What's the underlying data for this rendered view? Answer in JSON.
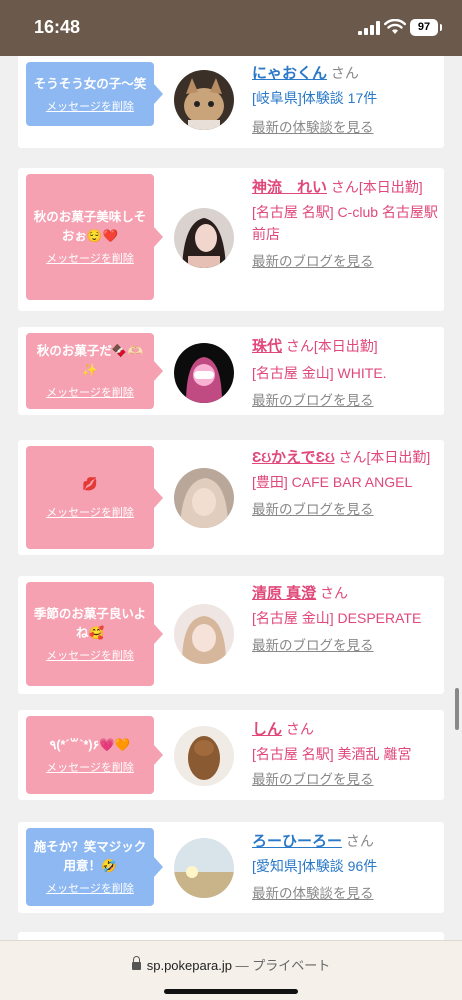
{
  "status_bar": {
    "time": "16:48",
    "battery": "97"
  },
  "feed": [
    {
      "bubble_text": "そうそう女の子〜笑",
      "delete_label": "メッセージを削除",
      "name": "にゃおくん",
      "honorific": "さん",
      "meta": "[岐阜県]体験談 17件",
      "link": "最新の体験談を見る"
    },
    {
      "bubble_text": "秋のお菓子美味しそおぉ😌❤️",
      "delete_label": "メッセージを削除",
      "name": "神流　れい",
      "honorific": "さん[本日出勤]",
      "meta": "[名古屋 名駅] C-club 名古屋駅前店",
      "link": "最新のブログを見る"
    },
    {
      "bubble_text": "秋のお菓子だ🍫🫶🏻✨",
      "delete_label": "メッセージを削除",
      "name": "珠代",
      "honorific": "さん[本日出勤]",
      "meta": "[名古屋 金山] WHITE.",
      "link": "最新のブログを見る"
    },
    {
      "bubble_text": "💋",
      "delete_label": "メッセージを削除",
      "name": "ƐઇかえでƐઇ",
      "honorific": "さん[本日出勤]",
      "meta": "[豊田] CAFE BAR ANGEL",
      "link": "最新のブログを見る"
    },
    {
      "bubble_text": "季節のお菓子良いよね🥰",
      "delete_label": "メッセージを削除",
      "name": "清原 真澄",
      "honorific": "さん",
      "meta": "[名古屋 金山] DESPERATE",
      "link": "最新のブログを見る"
    },
    {
      "bubble_text": "٩(*´꒳`*)۶💗🧡",
      "delete_label": "メッセージを削除",
      "name": "しん",
      "honorific": "さん",
      "meta": "[名古屋 名駅] 美酒乱 離宮",
      "link": "最新のブログを見る"
    },
    {
      "bubble_text": "施そか？笑マジック用意！🤣",
      "delete_label": "メッセージを削除",
      "name": "ろーひーろー",
      "honorific": "さん",
      "meta": "[愛知県]体験談 96件",
      "link": "最新の体験談を見る"
    }
  ],
  "browser": {
    "url": "sp.pokepara.jp",
    "privacy": "— プライベート"
  },
  "colors": {
    "blue_bubble": "#8db8f2",
    "pink_bubble": "#f5a1b2",
    "blue_text": "#2a78c8",
    "pink_text": "#e0487a",
    "status_bar": "#6b5a4b"
  }
}
